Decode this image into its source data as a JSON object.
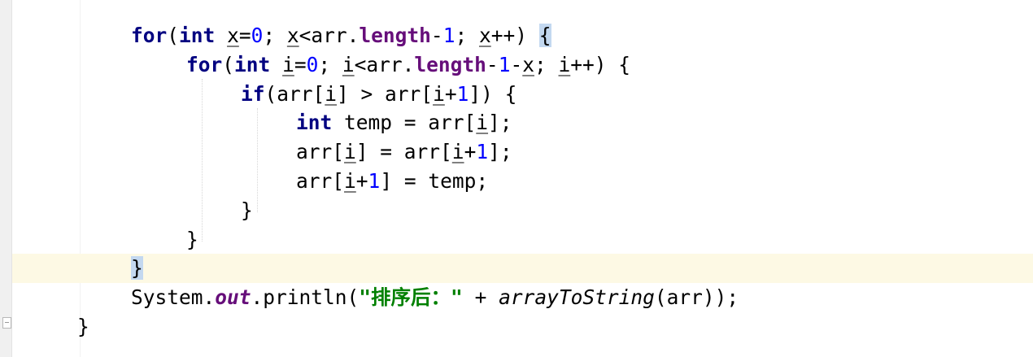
{
  "editor": {
    "lines": [
      {
        "indent": 1,
        "current": false,
        "tokens": [
          {
            "t": "for",
            "c": "kw"
          },
          {
            "t": "(",
            "c": ""
          },
          {
            "t": "int",
            "c": "kw"
          },
          {
            "t": " ",
            "c": ""
          },
          {
            "t": "x",
            "c": "u"
          },
          {
            "t": "=",
            "c": ""
          },
          {
            "t": "0",
            "c": "num"
          },
          {
            "t": "; ",
            "c": ""
          },
          {
            "t": "x",
            "c": "u"
          },
          {
            "t": "<arr.",
            "c": ""
          },
          {
            "t": "length",
            "c": "fld"
          },
          {
            "t": "-",
            "c": ""
          },
          {
            "t": "1",
            "c": "num"
          },
          {
            "t": "; ",
            "c": ""
          },
          {
            "t": "x",
            "c": "u"
          },
          {
            "t": "++) ",
            "c": ""
          },
          {
            "t": "{",
            "c": "brace-hl"
          }
        ]
      },
      {
        "indent": 2,
        "current": false,
        "tokens": [
          {
            "t": "for",
            "c": "kw"
          },
          {
            "t": "(",
            "c": ""
          },
          {
            "t": "int",
            "c": "kw"
          },
          {
            "t": " ",
            "c": ""
          },
          {
            "t": "i",
            "c": "u"
          },
          {
            "t": "=",
            "c": ""
          },
          {
            "t": "0",
            "c": "num"
          },
          {
            "t": "; ",
            "c": ""
          },
          {
            "t": "i",
            "c": "u"
          },
          {
            "t": "<arr.",
            "c": ""
          },
          {
            "t": "length",
            "c": "fld"
          },
          {
            "t": "-",
            "c": ""
          },
          {
            "t": "1",
            "c": "num"
          },
          {
            "t": "-",
            "c": ""
          },
          {
            "t": "x",
            "c": "u"
          },
          {
            "t": "; ",
            "c": ""
          },
          {
            "t": "i",
            "c": "u"
          },
          {
            "t": "++) {",
            "c": ""
          }
        ]
      },
      {
        "indent": 3,
        "current": false,
        "tokens": [
          {
            "t": "if",
            "c": "kw"
          },
          {
            "t": "(arr[",
            "c": ""
          },
          {
            "t": "i",
            "c": "u"
          },
          {
            "t": "] > arr[",
            "c": ""
          },
          {
            "t": "i",
            "c": "u"
          },
          {
            "t": "+",
            "c": ""
          },
          {
            "t": "1",
            "c": "num"
          },
          {
            "t": "]) {",
            "c": ""
          }
        ]
      },
      {
        "indent": 4,
        "current": false,
        "tokens": [
          {
            "t": "int",
            "c": "kw"
          },
          {
            "t": " temp = arr[",
            "c": ""
          },
          {
            "t": "i",
            "c": "u"
          },
          {
            "t": "];",
            "c": ""
          }
        ]
      },
      {
        "indent": 4,
        "current": false,
        "tokens": [
          {
            "t": "arr[",
            "c": ""
          },
          {
            "t": "i",
            "c": "u"
          },
          {
            "t": "] = arr[",
            "c": ""
          },
          {
            "t": "i",
            "c": "u"
          },
          {
            "t": "+",
            "c": ""
          },
          {
            "t": "1",
            "c": "num"
          },
          {
            "t": "];",
            "c": ""
          }
        ]
      },
      {
        "indent": 4,
        "current": false,
        "tokens": [
          {
            "t": "arr[",
            "c": ""
          },
          {
            "t": "i",
            "c": "u"
          },
          {
            "t": "+",
            "c": ""
          },
          {
            "t": "1",
            "c": "num"
          },
          {
            "t": "] = temp;",
            "c": ""
          }
        ]
      },
      {
        "indent": 3,
        "current": false,
        "tokens": [
          {
            "t": "}",
            "c": ""
          }
        ]
      },
      {
        "indent": 2,
        "current": false,
        "tokens": [
          {
            "t": "}",
            "c": ""
          }
        ]
      },
      {
        "indent": 1,
        "current": true,
        "tokens": [
          {
            "t": "}",
            "c": "brace-hl"
          }
        ]
      },
      {
        "indent": 1,
        "current": false,
        "tokens": [
          {
            "t": "System.",
            "c": ""
          },
          {
            "t": "out",
            "c": "sfld"
          },
          {
            "t": ".println(",
            "c": ""
          },
          {
            "t": "\"排序后：\"",
            "c": "str"
          },
          {
            "t": " + ",
            "c": ""
          },
          {
            "t": "arrayToString",
            "c": "itl"
          },
          {
            "t": "(arr));",
            "c": ""
          }
        ]
      },
      {
        "indent": 0,
        "current": false,
        "tokens": [
          {
            "t": "}",
            "c": ""
          }
        ]
      }
    ]
  },
  "gutter": {
    "intention_icon": "lightbulb-icon",
    "fold_icon": "fold-marker-icon"
  },
  "colors": {
    "keyword": "#000080",
    "number": "#0000ff",
    "field": "#660e7a",
    "string": "#008000",
    "current_line": "#fdf9e4",
    "brace_match": "#c3d8f0"
  }
}
